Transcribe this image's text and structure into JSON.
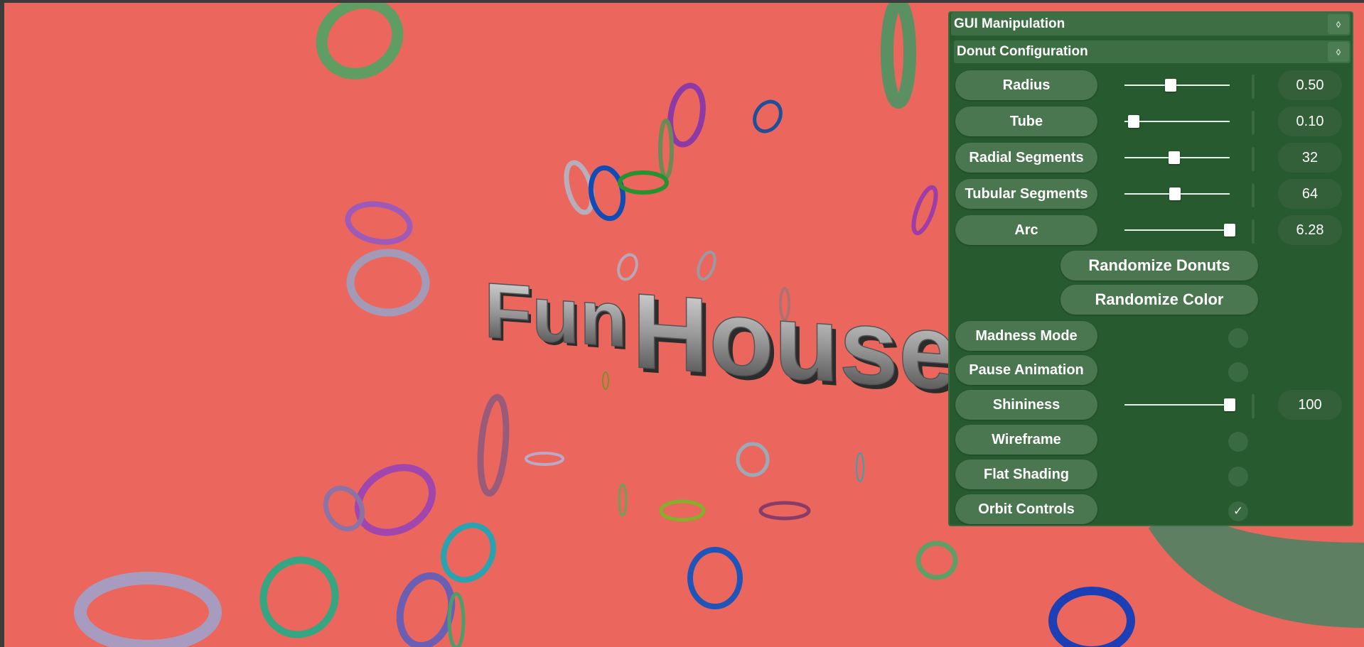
{
  "scene": {
    "title_word_1": "Fun",
    "title_word_2": "House",
    "background_color": "#eb675d"
  },
  "gui": {
    "title": "GUI Manipulation",
    "folder": "Donut Configuration",
    "controls": [
      {
        "label": "Radius",
        "type": "slider",
        "value": "0.50",
        "fraction": 0.44
      },
      {
        "label": "Tube",
        "type": "slider",
        "value": "0.10",
        "fraction": 0.09
      },
      {
        "label": "Radial Segments",
        "type": "slider",
        "value": "32",
        "fraction": 0.47
      },
      {
        "label": "Tubular Segments",
        "type": "slider",
        "value": "64",
        "fraction": 0.48
      },
      {
        "label": "Arc",
        "type": "slider",
        "value": "6.28",
        "fraction": 1.0
      }
    ],
    "buttons": {
      "randomize_donuts": "Randomize Donuts",
      "randomize_color": "Randomize Color"
    },
    "toggles": [
      {
        "label": "Madness Mode",
        "checked": false
      },
      {
        "label": "Pause Animation",
        "checked": false
      }
    ],
    "shininess": {
      "label": "Shininess",
      "value": "100",
      "fraction": 1.0
    },
    "toggles_bottom": [
      {
        "label": "Wireframe",
        "checked": false
      },
      {
        "label": "Flat Shading",
        "checked": false
      },
      {
        "label": "Orbit Controls",
        "checked": true
      }
    ],
    "panel_color": "#275a2f",
    "pill_color": "#4a7750"
  }
}
